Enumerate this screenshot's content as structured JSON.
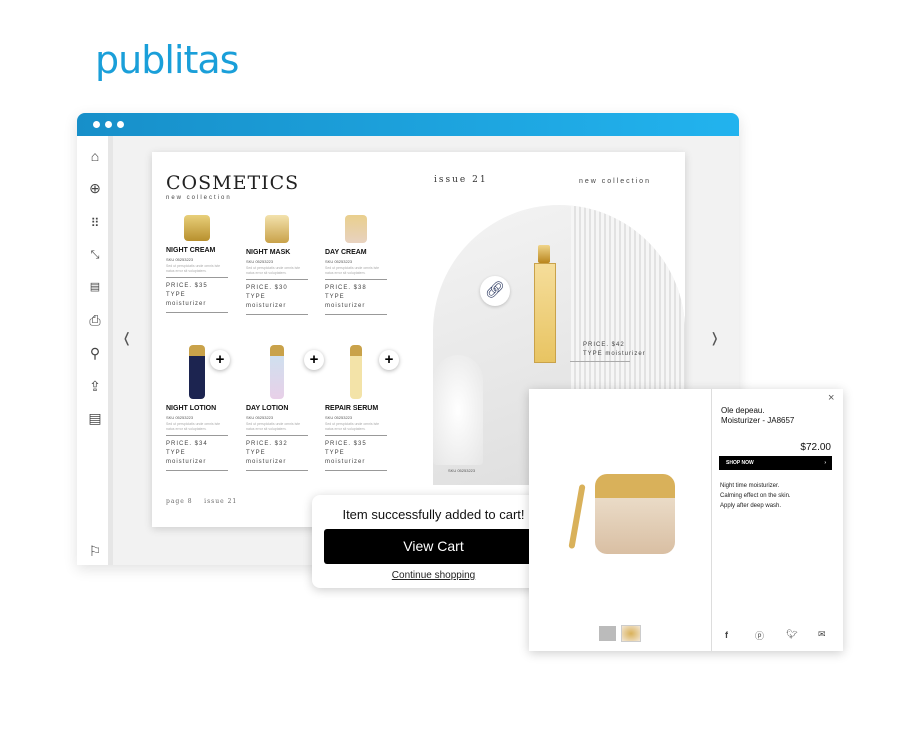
{
  "logo": "publitas",
  "window": {
    "accent": "#1a9fd9"
  },
  "sidebar": {
    "icons": [
      "home-icon",
      "zoom-in-icon",
      "grid-icon",
      "fullscreen-icon",
      "pdf-download-icon",
      "print-icon",
      "search-icon",
      "share-icon",
      "notes-icon",
      "flag-icon"
    ]
  },
  "page": {
    "title": "COSMETICS",
    "subtitle": "new collection",
    "issue": "issue 21",
    "collection": "new collection",
    "footer": "page 8    issue 21",
    "products": [
      {
        "name": "NIGHT CREAM",
        "sku": "SKU 05253223",
        "desc": "Sed ut perspiciatis unde omnis iste natus error sit voluptatem.",
        "price": "PRICE. $35",
        "type": "TYPE moisturizer"
      },
      {
        "name": "NIGHT MASK",
        "sku": "SKU 05253223",
        "desc": "Sed ut perspiciatis unde omnis iste natus error sit voluptatem.",
        "price": "PRICE. $30",
        "type": "TYPE moisturizer"
      },
      {
        "name": "DAY CREAM",
        "sku": "SKU 05253223",
        "desc": "Sed ut perspiciatis unde omnis iste natus error sit voluptatem.",
        "price": "PRICE. $38",
        "type": "TYPE moisturizer"
      },
      {
        "name": "NIGHT LOTION",
        "sku": "SKU 05253223",
        "desc": "Sed ut perspiciatis unde omnis iste natus error sit voluptatem.",
        "price": "PRICE. $34",
        "type": "TYPE moisturizer"
      },
      {
        "name": "DAY LOTION",
        "sku": "SKU 05253223",
        "desc": "Sed ut perspiciatis unde omnis iste natus error sit voluptatem.",
        "price": "PRICE. $32",
        "type": "TYPE moisturizer"
      },
      {
        "name": "REPAIR SERUM",
        "sku": "SKU 05253223",
        "desc": "Sed ut perspiciatis unde omnis iste natus error sit voluptatem.",
        "price": "PRICE. $35",
        "type": "TYPE moisturizer"
      }
    ],
    "feature": {
      "price": "PRICE. $42",
      "type": "TYPE moisturizer",
      "sku": "SKU 05253223"
    }
  },
  "cart": {
    "message": "Item successfully added to cart!",
    "view_cart": "View Cart",
    "continue": "Continue shopping"
  },
  "popup": {
    "brand": "Ole depeau.",
    "product": "Moisturizer - JA8657",
    "price": "$72.00",
    "shop_now": "SHOP NOW",
    "desc": [
      "Night time moisturizer.",
      "Calming effect on the skin.",
      "Apply after deep wash."
    ],
    "close": "×",
    "share": [
      "facebook-icon",
      "pinterest-icon",
      "twitter-icon",
      "email-icon"
    ]
  }
}
